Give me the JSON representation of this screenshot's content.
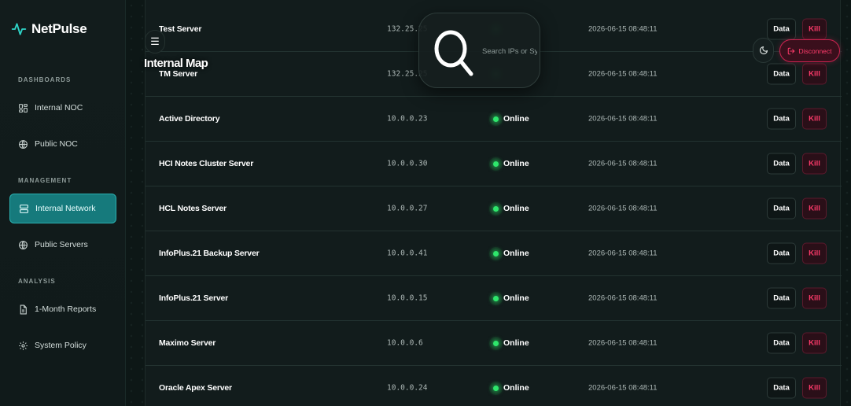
{
  "app": {
    "name": "NetPulse"
  },
  "sidebar": {
    "sections": [
      {
        "label": "DASHBOARDS",
        "items": [
          {
            "label": "Internal NOC",
            "icon": "grid-icon",
            "active": false
          },
          {
            "label": "Public NOC",
            "icon": "globe-icon",
            "active": false
          }
        ]
      },
      {
        "label": "MANAGEMENT",
        "items": [
          {
            "label": "Internal Network",
            "icon": "server-icon",
            "active": true
          },
          {
            "label": "Public Servers",
            "icon": "globe-icon",
            "active": false
          }
        ]
      },
      {
        "label": "ANALYSIS",
        "items": [
          {
            "label": "1-Month Reports",
            "icon": "document-icon",
            "active": false
          },
          {
            "label": "System Policy",
            "icon": "gear-icon",
            "active": false
          }
        ]
      }
    ]
  },
  "header": {
    "menu_glyph": "☰",
    "title": "Internal Map",
    "search_placeholder": "Search IPs or Sy",
    "disconnect_label": "Disconnect"
  },
  "colors": {
    "accent": "#167a7c",
    "online": "#2ee66b",
    "kill": "#ff3b6b"
  },
  "servers": [
    {
      "name": "Test Server",
      "ip": "132.25.25",
      "status": "",
      "time": "2026-06-15 08:48:11",
      "data_label": "Data",
      "kill_label": "Kill"
    },
    {
      "name": "TM Server",
      "ip": "132.25.25",
      "status": "",
      "time": "2026-06-15 08:48:11",
      "data_label": "Data",
      "kill_label": "Kill"
    },
    {
      "name": "Active Directory",
      "ip": "10.0.0.23",
      "status": "Online",
      "time": "2026-06-15 08:48:11",
      "data_label": "Data",
      "kill_label": "Kill"
    },
    {
      "name": "HCI Notes Cluster Server",
      "ip": "10.0.0.30",
      "status": "Online",
      "time": "2026-06-15 08:48:11",
      "data_label": "Data",
      "kill_label": "Kill"
    },
    {
      "name": "HCL Notes Server",
      "ip": "10.0.0.27",
      "status": "Online",
      "time": "2026-06-15 08:48:11",
      "data_label": "Data",
      "kill_label": "Kill"
    },
    {
      "name": "InfoPlus.21 Backup Server",
      "ip": "10.0.0.41",
      "status": "Online",
      "time": "2026-06-15 08:48:11",
      "data_label": "Data",
      "kill_label": "Kill"
    },
    {
      "name": "InfoPlus.21 Server",
      "ip": "10.0.0.15",
      "status": "Online",
      "time": "2026-06-15 08:48:11",
      "data_label": "Data",
      "kill_label": "Kill"
    },
    {
      "name": "Maximo Server",
      "ip": "10.0.0.6",
      "status": "Online",
      "time": "2026-06-15 08:48:11",
      "data_label": "Data",
      "kill_label": "Kill"
    },
    {
      "name": "Oracle Apex Server",
      "ip": "10.0.0.24",
      "status": "Online",
      "time": "2026-06-15 08:48:11",
      "data_label": "Data",
      "kill_label": "Kill"
    }
  ]
}
